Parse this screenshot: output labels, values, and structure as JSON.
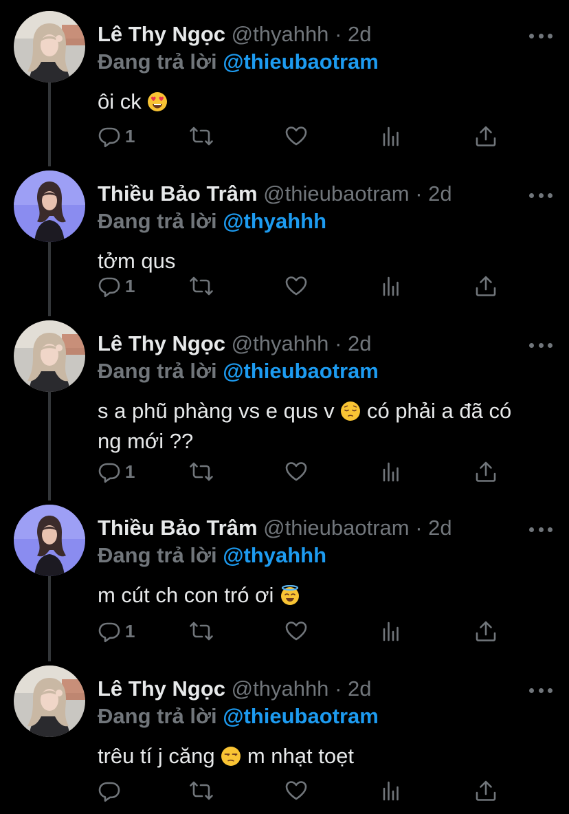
{
  "tweets": [
    {
      "name": "Lê Thy Ngọc",
      "handle": "@thyahhh",
      "time": "2d",
      "replying_label": "Đang trả lời",
      "replying_to": "@thieubaotram",
      "text_before": "ôi ck",
      "emoji": "heart-eyes",
      "text_after": "",
      "text_tail": "",
      "reply_count": "1",
      "avatar": "thy"
    },
    {
      "name": "Thiều Bảo Trâm",
      "handle": "@thieubaotram",
      "time": "2d",
      "replying_label": "Đang trả lời",
      "replying_to": "@thyahhh",
      "text_before": "tởm qus",
      "emoji": "",
      "text_after": "",
      "text_tail": "",
      "reply_count": "1",
      "avatar": "tram"
    },
    {
      "name": "Lê Thy Ngọc",
      "handle": "@thyahhh",
      "time": "2d",
      "replying_label": "Đang trả lời",
      "replying_to": "@thieubaotram",
      "text_before": "s a phũ phàng vs e qus v",
      "emoji": "pensive",
      "text_after": "có phải a đã có",
      "text_tail": "ng mới ??",
      "reply_count": "1",
      "avatar": "thy"
    },
    {
      "name": "Thiều Bảo Trâm",
      "handle": "@thieubaotram",
      "time": "2d",
      "replying_label": "Đang trả lời",
      "replying_to": "@thyahhh",
      "text_before": "m cút ch con tró ơi",
      "emoji": "halo",
      "text_after": "",
      "text_tail": "",
      "reply_count": "1",
      "avatar": "tram"
    },
    {
      "name": "Lê Thy Ngọc",
      "handle": "@thyahhh",
      "time": "2d",
      "replying_label": "Đang trả lời",
      "replying_to": "@thieubaotram",
      "text_before": "trêu tí j căng",
      "emoji": "unamused",
      "text_after": "m nhạt toẹt",
      "text_tail": "",
      "reply_count": "",
      "avatar": "thy"
    }
  ],
  "icons": {
    "reply": "reply-icon",
    "retweet": "retweet-icon",
    "like": "heart-icon",
    "views": "analytics-icon",
    "share": "share-icon",
    "more": "more-icon"
  },
  "colors": {
    "background": "#000000",
    "primary_text": "#e7e9ea",
    "secondary_text": "#71767b",
    "mention": "#1d9bf0",
    "thread_line": "#333639"
  }
}
